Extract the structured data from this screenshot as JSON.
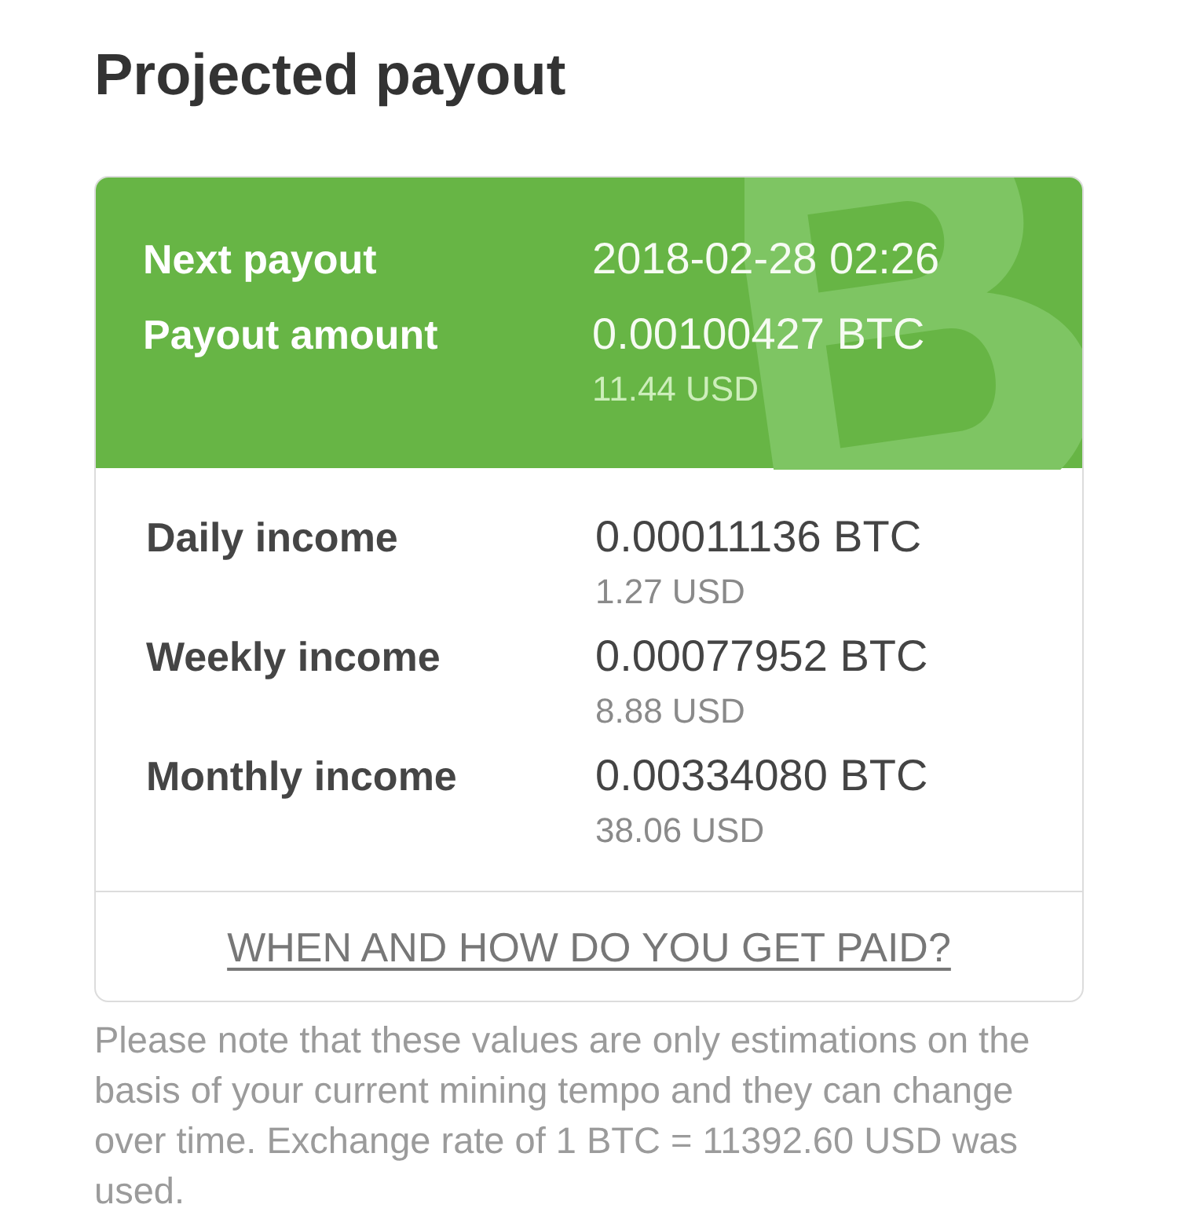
{
  "title": "Projected payout",
  "payout": {
    "rows": [
      {
        "label": "Next payout",
        "value": "2018-02-28 02:26"
      },
      {
        "label": "Payout amount",
        "value": "0.00100427 BTC",
        "sub_value": "11.44 USD"
      }
    ]
  },
  "income": {
    "rows": [
      {
        "label": "Daily income",
        "value": "0.00011136 BTC",
        "sub_value": "1.27 USD"
      },
      {
        "label": "Weekly income",
        "value": "0.00077952 BTC",
        "sub_value": "8.88 USD"
      },
      {
        "label": "Monthly income",
        "value": "0.00334080 BTC",
        "sub_value": "38.06 USD"
      }
    ]
  },
  "help_link": "WHEN AND HOW DO YOU GET PAID?",
  "note": "Please note that these values are only estimations on the basis of your current mining tempo and they can change over time. Exchange rate of 1 BTC = 11392.60 USD was used."
}
